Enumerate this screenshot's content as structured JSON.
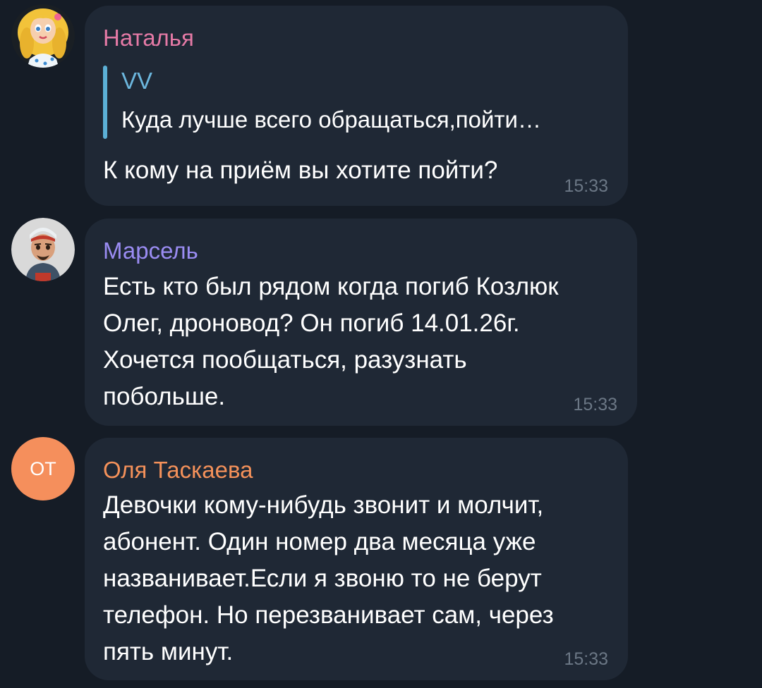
{
  "messages": [
    {
      "sender": "Наталья",
      "sender_color": "#e57aa6",
      "avatar_icon": "cartoon-girl-avatar",
      "reply": {
        "name": "VV",
        "text": "Куда лучше всего обращаться,пойти…"
      },
      "text": "К кому на приём вы хотите пойти?",
      "time": "15:33"
    },
    {
      "sender": "Марсель",
      "sender_color": "#9a8cf2",
      "avatar_icon": "cartoon-boy-avatar",
      "text": "Есть кто был рядом когда погиб Козлюк\nОлег, дроновод? Он погиб 14.01.26г.\nХочется пообщаться, разузнать\nпобольше.",
      "time": "15:33"
    },
    {
      "sender": "Оля Таскаева",
      "sender_color": "#f4915a",
      "avatar_initials": "ОТ",
      "avatar_color": "#f58f5c",
      "text": "Девочки  кому-нибудь звонит и молчит,\nабонент. Один номер два месяца уже\nназванивает.Если я звоню то не берут\nтелефон. Но перезванивает сам, через\nпять минут.",
      "time": "15:33"
    }
  ]
}
